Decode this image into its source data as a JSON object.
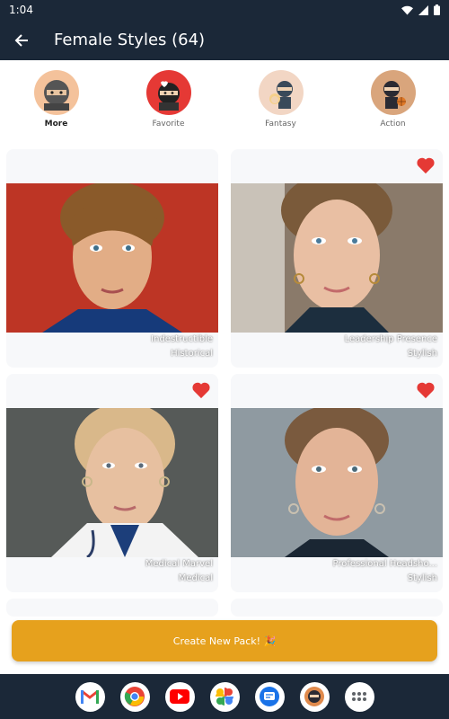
{
  "status_bar": {
    "time": "1:04"
  },
  "app_bar": {
    "title": "Female Styles (64)"
  },
  "categories": [
    {
      "label": "More",
      "bg": "#f4c29b"
    },
    {
      "label": "Favorite",
      "bg": "#e53935"
    },
    {
      "label": "Fantasy",
      "bg": "#f2d6c4"
    },
    {
      "label": "Action",
      "bg": "#d9a57c"
    }
  ],
  "cards": [
    {
      "title": "Indestructible",
      "category": "Historical",
      "favorited": false
    },
    {
      "title": "Leadership Presence",
      "category": "Stylish",
      "favorited": true
    },
    {
      "title": "Medical Marvel",
      "category": "Medical",
      "favorited": true
    },
    {
      "title": "Professional Headsho...",
      "category": "Stylish",
      "favorited": true
    }
  ],
  "create_button": {
    "label": "Create New Pack! 🎉"
  },
  "dock": [
    "gmail-icon",
    "chrome-icon",
    "youtube-icon",
    "photos-icon",
    "messages-icon",
    "app-icon",
    "apps-icon"
  ],
  "colors": {
    "bar": "#1b2838",
    "accent": "#e6a11d",
    "heart": "#e53935"
  }
}
